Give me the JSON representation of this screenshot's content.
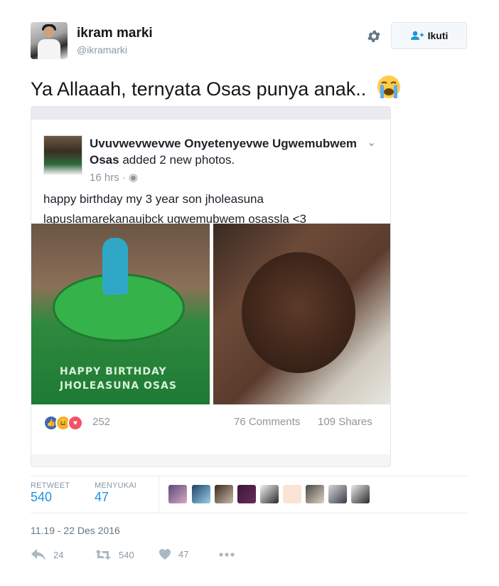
{
  "user": {
    "name": "ikram marki",
    "handle": "@ikramarki"
  },
  "follow_button": {
    "label": "Ikuti"
  },
  "tweet": {
    "text": "Ya Allaaah, ternyata Osas punya anak..",
    "emoji": "loudly-crying-face"
  },
  "fb_post": {
    "author": "Uvuvwevwevwe Onyetenyevwe Ugwemubwem Osas",
    "action": "added 2 new photos.",
    "time": "16 hrs",
    "caption": "happy birthday my 3 year  son jholeasuna lapuslamarekanaujbck ugwemubwem osassla <3",
    "cake_text_1": "HAPPY BIRTHDAY",
    "cake_text_2": "JHOLEASUNA OSAS",
    "reaction_count": "252",
    "comments": "76 Comments",
    "shares": "109 Shares"
  },
  "stats": {
    "retweet_label": "RETWEET",
    "retweet_value": "540",
    "likes_label": "MENYUKAI",
    "likes_value": "47"
  },
  "timestamp": "11.19 - 22 Des 2016",
  "actions": {
    "reply_count": "24",
    "retweet_count": "540",
    "like_count": "47"
  },
  "colors": {
    "accent": "#1b95e0",
    "secondary_text": "#8899a6",
    "fb_blue": "#4267b2"
  }
}
